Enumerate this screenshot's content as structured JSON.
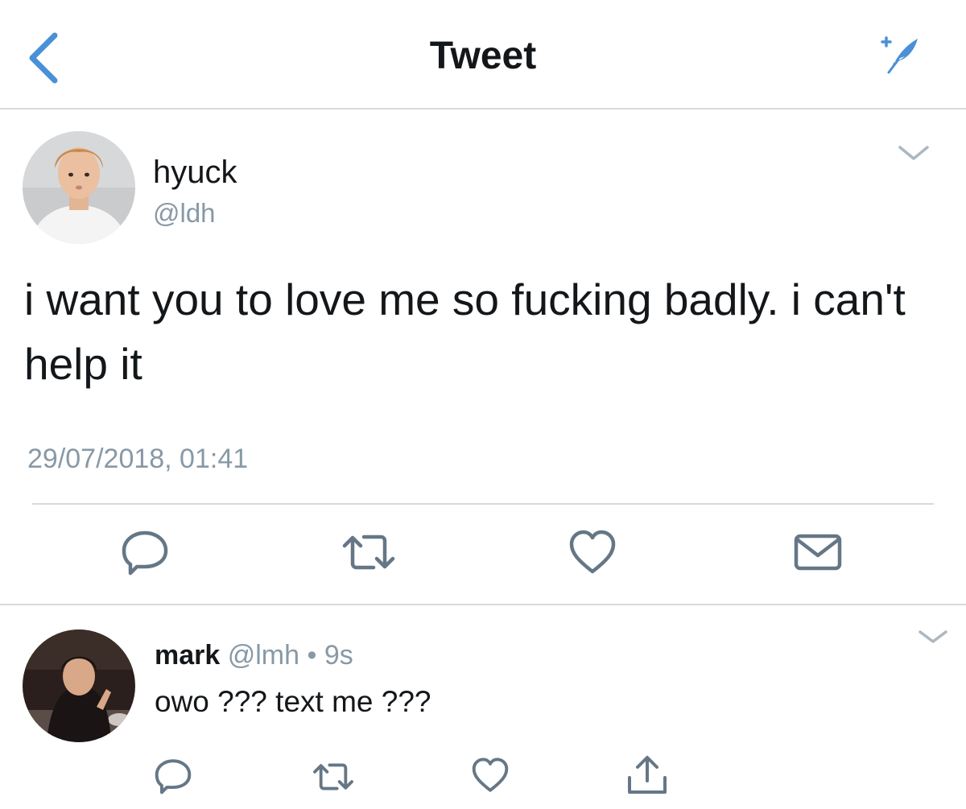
{
  "header": {
    "title": "Tweet",
    "back_icon": "chevron-left-icon",
    "compose_icon": "compose-feather-icon",
    "accent_color": "#4a90d6"
  },
  "main_tweet": {
    "display_name": "hyuck",
    "handle": "@ldh",
    "text": "i want you to love me so fucking badly. i can't help it",
    "timestamp": "29/07/2018, 01:41",
    "actions": [
      "reply-icon",
      "retweet-icon",
      "like-icon",
      "message-icon"
    ]
  },
  "reply_tweet": {
    "display_name": "mark",
    "handle": "@lmh",
    "separator": " • ",
    "age": "9s",
    "text": "owo ??? text me ???",
    "actions": [
      "reply-icon",
      "retweet-icon",
      "like-icon",
      "share-icon"
    ]
  },
  "colors": {
    "text": "#14171a",
    "secondary": "#8899a6",
    "divider": "#d6dbe0",
    "icon": "#657786"
  }
}
